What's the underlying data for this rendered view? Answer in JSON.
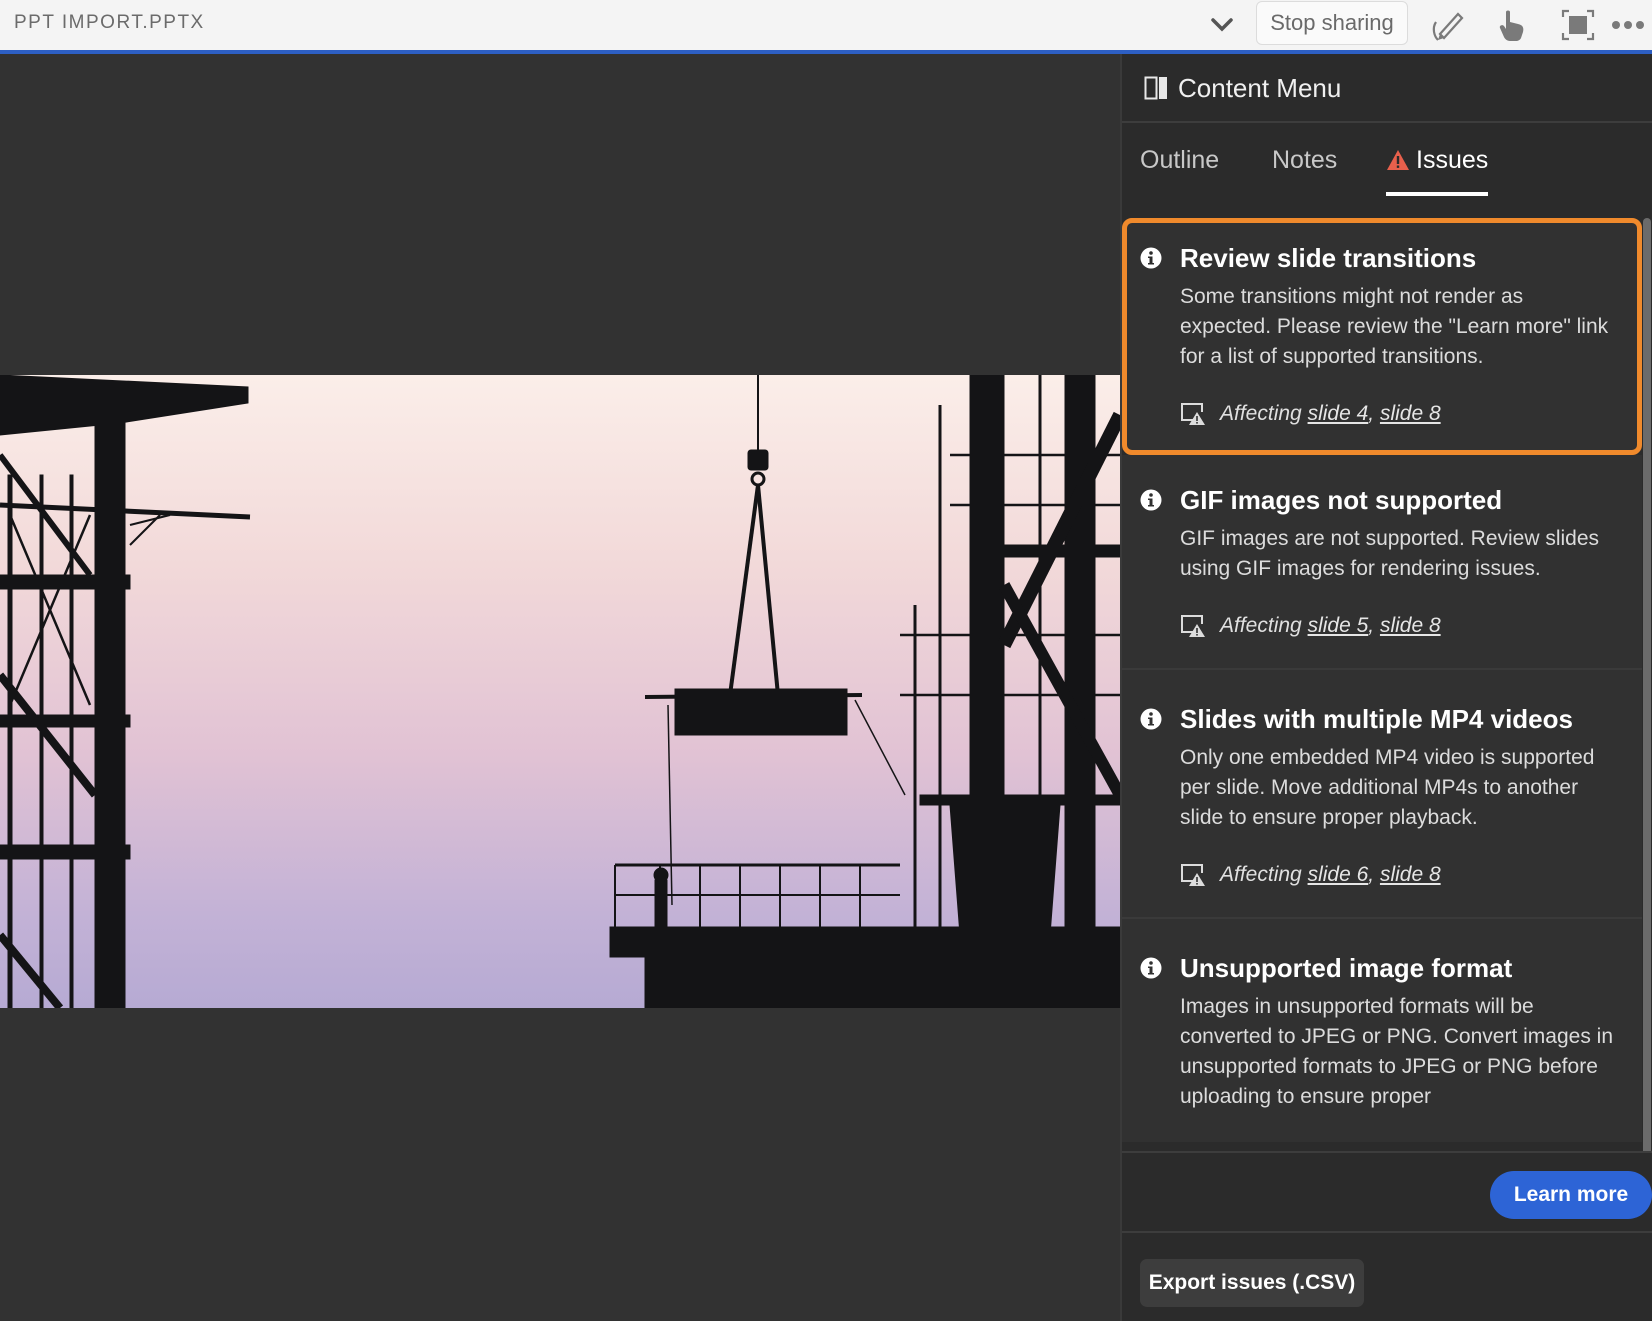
{
  "topbar": {
    "title": "PPT IMPORT.PPTX",
    "stop_sharing_label": "Stop sharing",
    "icons": [
      "chevron-down-icon",
      "pen-annotate-icon",
      "pointer-hand-icon",
      "fullscreen-icon",
      "more-options-icon"
    ]
  },
  "panel": {
    "title": "Content Menu",
    "tabs": [
      {
        "label": "Outline",
        "active": false
      },
      {
        "label": "Notes",
        "active": false
      },
      {
        "label": "Issues",
        "active": true
      }
    ],
    "issues": [
      {
        "title": "Review slide transitions",
        "description": "Some transitions might not render as expected. Please review the \"Learn more\" link for a list of supported transitions.",
        "affecting_label": "Affecting",
        "slides": [
          "slide 4",
          "slide 8"
        ],
        "highlighted": true
      },
      {
        "title": "GIF images not supported",
        "description": "GIF images are not supported. Review slides using GIF images for rendering issues.",
        "affecting_label": "Affecting",
        "slides": [
          "slide 5",
          "slide 8"
        ],
        "highlighted": false
      },
      {
        "title": "Slides with multiple MP4 videos",
        "description": "Only one embedded MP4 video is supported per slide. Move additional MP4s to another slide to ensure proper playback.",
        "affecting_label": "Affecting",
        "slides": [
          "slide 6",
          "slide 8"
        ],
        "highlighted": false
      },
      {
        "title": "Unsupported image format",
        "description": "Images in unsupported formats will be converted to JPEG or PNG. Convert images in unsupported formats to JPEG or PNG before uploading to ensure proper",
        "highlighted": false
      }
    ],
    "learn_more_label": "Learn more",
    "export_label": "Export issues (.CSV)"
  },
  "colors": {
    "accent_blue": "#2d64d6",
    "topbar_line": "#2d5fc4",
    "highlight_orange": "#f08a2c",
    "warning_red": "#e8604c"
  },
  "slide": {
    "description": "Silhouette of construction site with crane lifting a load at dusk"
  }
}
